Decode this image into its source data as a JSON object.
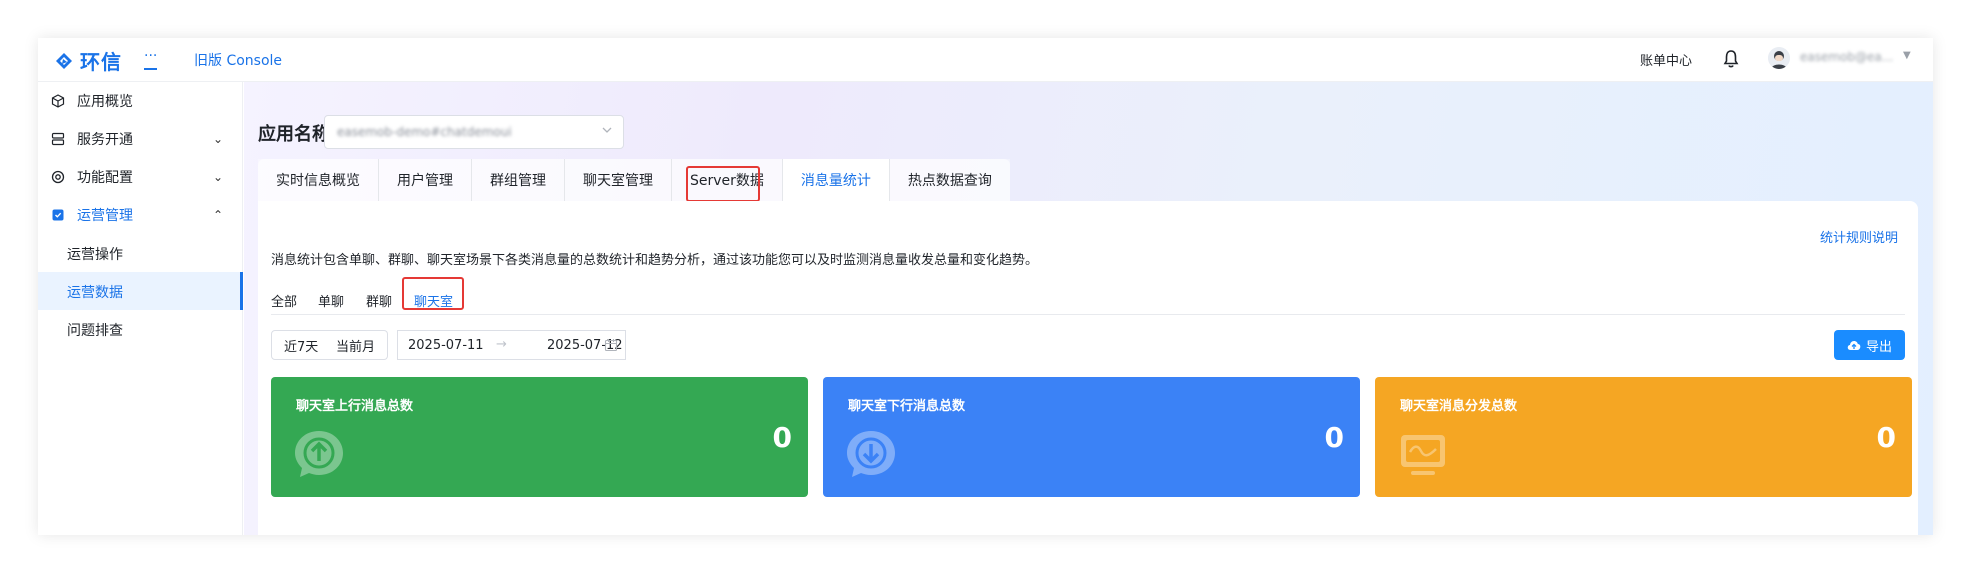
{
  "header": {
    "brand": "环信",
    "more": "···",
    "old_console": "旧版 Console",
    "billing": "账单中心",
    "user_name": "easemob@ea...",
    "user_caret": "▼"
  },
  "sidebar": {
    "items": [
      {
        "label": "应用概览",
        "icon": "cube-icon"
      },
      {
        "label": "服务开通",
        "icon": "service-icon",
        "chevron": "⌄"
      },
      {
        "label": "功能配置",
        "icon": "target-icon",
        "chevron": "⌄"
      },
      {
        "label": "运营管理",
        "icon": "ops-icon",
        "chevron": "⌃"
      }
    ],
    "sub_items": [
      {
        "label": "运营操作"
      },
      {
        "label": "运营数据"
      },
      {
        "label": "问题排查"
      }
    ]
  },
  "app": {
    "label": "应用名称",
    "selected_app": "easemob-demo#chatdemoui"
  },
  "tabs": [
    {
      "label": "实时信息概览"
    },
    {
      "label": "用户管理"
    },
    {
      "label": "群组管理"
    },
    {
      "label": "聊天室管理"
    },
    {
      "label": "Server数据"
    },
    {
      "label": "消息量统计"
    },
    {
      "label": "热点数据查询"
    }
  ],
  "content": {
    "rules_link": "统计规则说明",
    "description": "消息统计包含单聊、群聊、聊天室场景下各类消息量的总数统计和趋势分析，通过该功能您可以及时监测消息量收发总量和变化趋势。",
    "subtabs": [
      {
        "label": "全部"
      },
      {
        "label": "单聊"
      },
      {
        "label": "群聊"
      },
      {
        "label": "聊天室"
      }
    ],
    "filters": {
      "last7": "近7天",
      "this_month": "当前月",
      "start_date": "2025-07-11",
      "arrow": "→",
      "end_date": "2025-07-12"
    },
    "export_label": "导出",
    "stats": [
      {
        "title": "聊天室上行消息总数",
        "value": "0",
        "color": "#34a853",
        "icon": "upload-bubble-icon"
      },
      {
        "title": "聊天室下行消息总数",
        "value": "0",
        "color": "#3b82f6",
        "icon": "download-bubble-icon"
      },
      {
        "title": "聊天室消息分发总数",
        "value": "0",
        "color": "#f5a623",
        "icon": "distribute-monitor-icon"
      }
    ]
  },
  "colors": {
    "accent": "#1a73e8",
    "highlight_box": "#e53935"
  }
}
